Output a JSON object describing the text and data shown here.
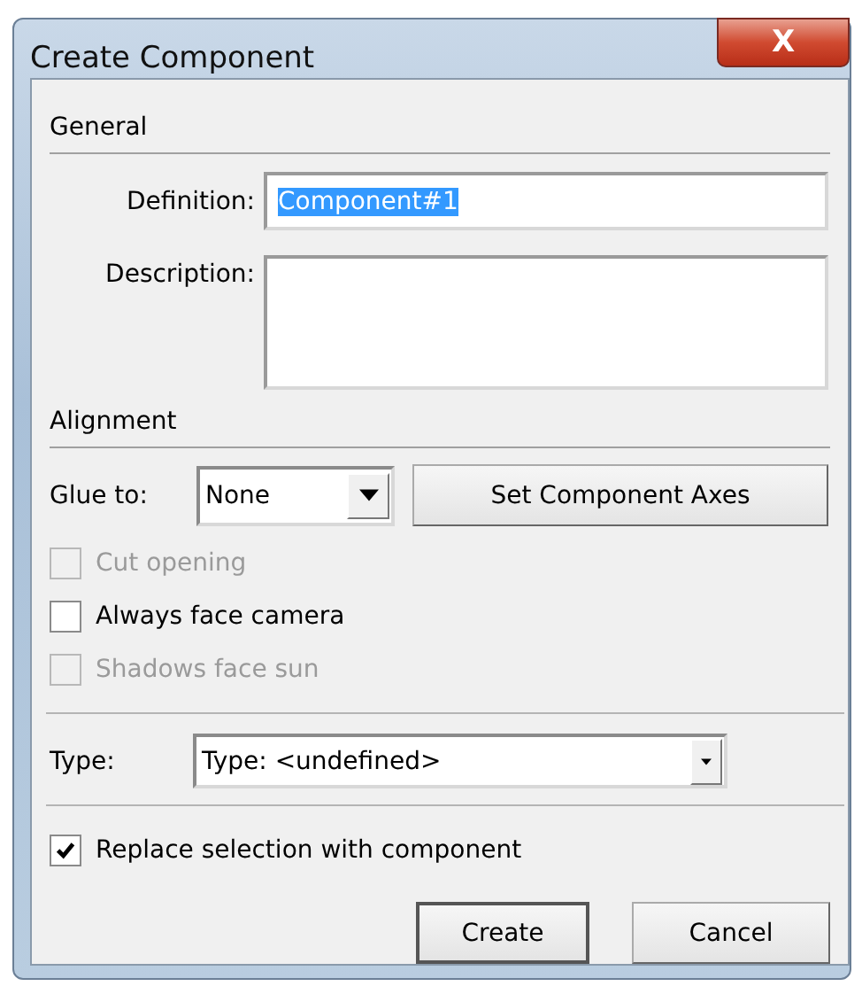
{
  "window": {
    "title": "Create Component",
    "close_label": "X"
  },
  "general": {
    "heading": "General",
    "definition": {
      "label": "Definition:",
      "value": "Component#1",
      "text_selected": true
    },
    "description": {
      "label": "Description:"
    }
  },
  "alignment": {
    "heading": "Alignment",
    "glue_to": {
      "label": "Glue to:",
      "value": "None"
    },
    "axes_button": "Set Component Axes",
    "options": [
      {
        "label": "Cut opening",
        "checked": false,
        "disabled": true
      },
      {
        "label": "Always face camera",
        "checked": false,
        "disabled": false
      },
      {
        "label": "Shadows face sun",
        "checked": false,
        "disabled": true
      }
    ]
  },
  "type": {
    "label": "Type:",
    "value": "Type: <undefined>"
  },
  "replace": {
    "label": "Replace selection with component",
    "checked": true,
    "disabled": false
  },
  "buttons": [
    "Create",
    "Cancel"
  ]
}
